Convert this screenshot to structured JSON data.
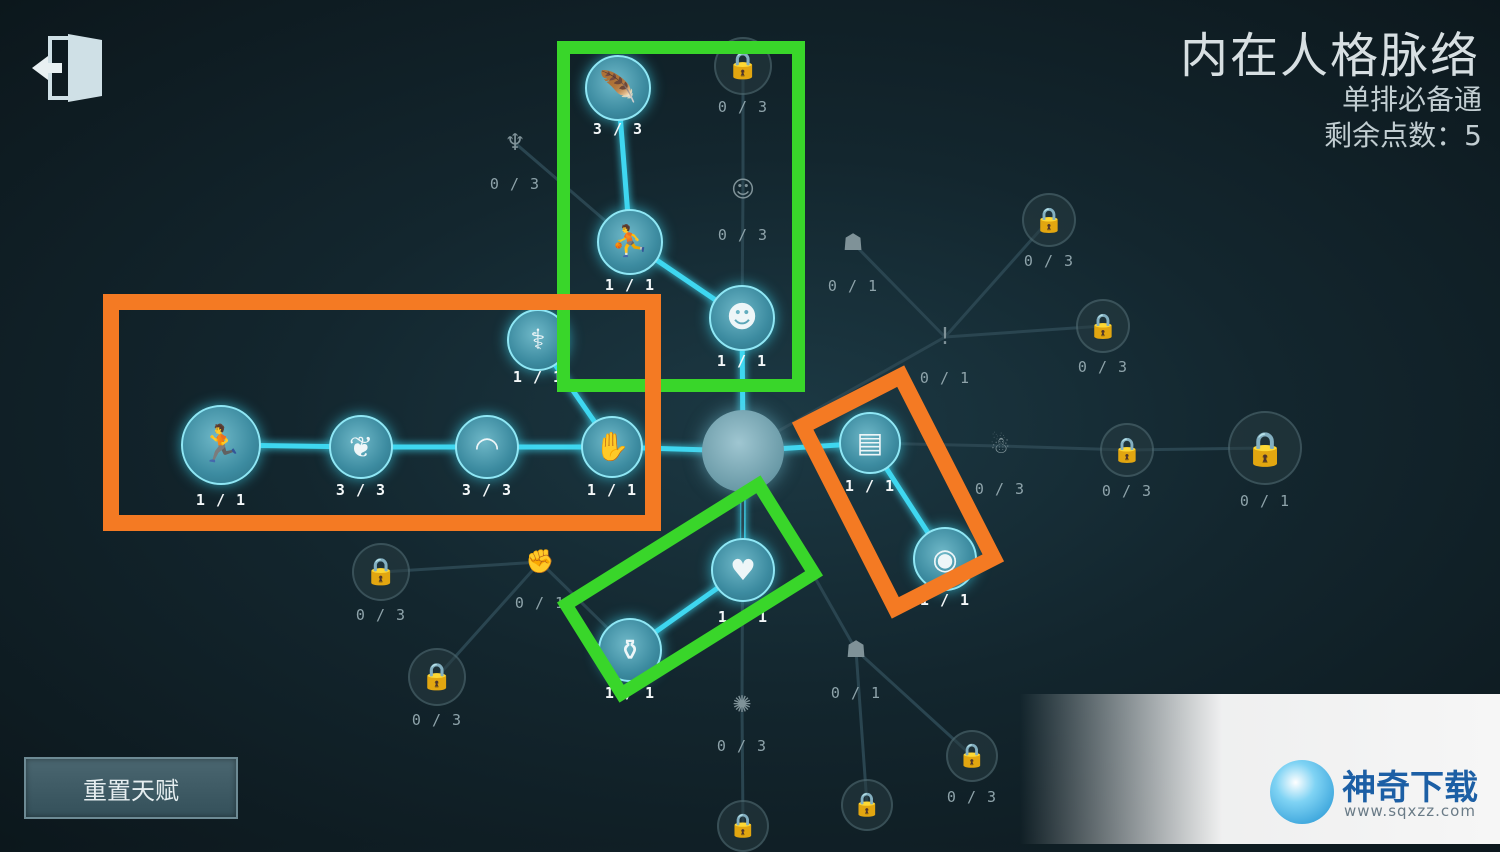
{
  "header": {
    "title": "内在人格脉络",
    "subtitle": "单排必备通",
    "points_text": "剩余点数：5"
  },
  "buttons": {
    "exit_icon": "exit-door-icon",
    "reset_label": "重置天赋"
  },
  "colors": {
    "active_link": "#3fd7f0",
    "green_highlight": "#39d62a",
    "orange_highlight": "#f47a23"
  },
  "talent_nodes": [
    {
      "icon": "feather-icon",
      "label": "3 / 3",
      "active": true
    },
    {
      "icon": "lock-icon",
      "label": "0 / 3",
      "active": false
    },
    {
      "icon": "scarecrow-icon",
      "label": "0 / 3",
      "active": false
    },
    {
      "icon": "hair-bust-icon",
      "label": "0 / 3",
      "active": false
    },
    {
      "icon": "crouch-figure-icon",
      "label": "1 / 1",
      "active": true
    },
    {
      "icon": "hooded-figure-icon",
      "label": "0 / 1",
      "active": false
    },
    {
      "icon": "lock-icon",
      "label": "0 / 3",
      "active": false
    },
    {
      "icon": "thinking-figure-icon",
      "label": "1 / 1",
      "active": true
    },
    {
      "icon": "broken-arm-icon",
      "label": "1 / 1",
      "active": true
    },
    {
      "icon": "alert-figure-icon",
      "label": "0 / 1",
      "active": false
    },
    {
      "icon": "lock-icon",
      "label": "0 / 3",
      "active": false
    },
    {
      "icon": "running-figure-icon",
      "label": "1 / 1",
      "active": true
    },
    {
      "icon": "grass-figure-icon",
      "label": "3 / 3",
      "active": true
    },
    {
      "icon": "wave-arc-icon",
      "label": "3 / 3",
      "active": true
    },
    {
      "icon": "hand-palm-icon",
      "label": "1 / 1",
      "active": true
    },
    {
      "icon": "toolbox-icon",
      "label": "1 / 1",
      "active": true
    },
    {
      "icon": "dancer-icon",
      "label": "0 / 3",
      "active": false
    },
    {
      "icon": "lock-icon",
      "label": "0 / 3",
      "active": false
    },
    {
      "icon": "lock-icon",
      "label": "0 / 1",
      "active": false
    },
    {
      "icon": "eye-icon",
      "label": "1 / 1",
      "active": true
    },
    {
      "icon": "lock-icon",
      "label": "0 / 3",
      "active": false
    },
    {
      "icon": "fist-icon",
      "label": "0 / 1",
      "active": false
    },
    {
      "icon": "heart-chart-icon",
      "label": "1 / 1",
      "active": true
    },
    {
      "icon": "kettle-icon",
      "label": "1 / 1",
      "active": true
    },
    {
      "icon": "lock-icon",
      "label": "0 / 3",
      "active": false
    },
    {
      "icon": "lantern-icon",
      "label": "0 / 3",
      "active": false
    },
    {
      "icon": "strongman-icon",
      "label": "0 / 1",
      "active": false
    },
    {
      "icon": "lock-icon",
      "label": "0 / 3",
      "active": false
    },
    {
      "icon": "lock-icon",
      "label": "",
      "active": false
    },
    {
      "icon": "lock-icon",
      "label": "",
      "active": false
    }
  ],
  "watermark": {
    "name": "神奇下载",
    "url": "www.sqxzz.com"
  }
}
